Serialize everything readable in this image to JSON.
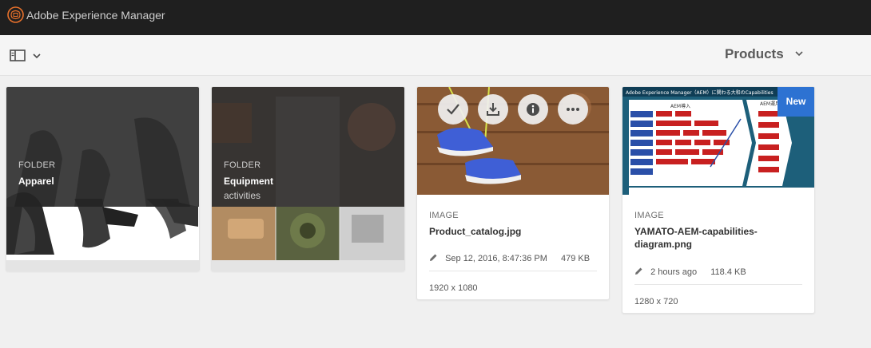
{
  "header": {
    "app_title": "Adobe Experience Manager",
    "logo_icon": "adobe-aem-logo-icon"
  },
  "toolbar": {
    "rail_toggle_icon": "rail-toggle-icon",
    "breadcrumb_label": "Products"
  },
  "cards": [
    {
      "kind": "folder",
      "type_label": "FOLDER",
      "title": "Apparel",
      "subtitle": ""
    },
    {
      "kind": "folder",
      "type_label": "FOLDER",
      "title": "Equipment",
      "subtitle": "activities"
    },
    {
      "kind": "image",
      "type_label": "IMAGE",
      "title": "Product_catalog.jpg",
      "modified": "Sep 12, 2016, 8:47:36 PM",
      "size": "479 KB",
      "dimensions": "1920 x 1080",
      "quick_actions": [
        "check-icon",
        "download-icon",
        "info-icon",
        "more-icon"
      ]
    },
    {
      "kind": "image",
      "type_label": "IMAGE",
      "title": "YAMATO-AEM-capabilities-diagram.png",
      "title_line1": "YAMATO-AEM-capabilities-",
      "title_line2": "diagram.png",
      "modified": "2 hours ago",
      "size": "118.4 KB",
      "dimensions": "1280 x 720",
      "badge": "New",
      "thumbnail_caption": "Adobe Experience Manager（AEM）に関わる大和のCapabilities",
      "thumbnail_sections": [
        "AEM導入",
        "AEM運用"
      ]
    }
  ],
  "colors": {
    "topbar": "#1f1f1f",
    "badge_blue": "#2d72d2",
    "background": "#f0f0f0"
  }
}
